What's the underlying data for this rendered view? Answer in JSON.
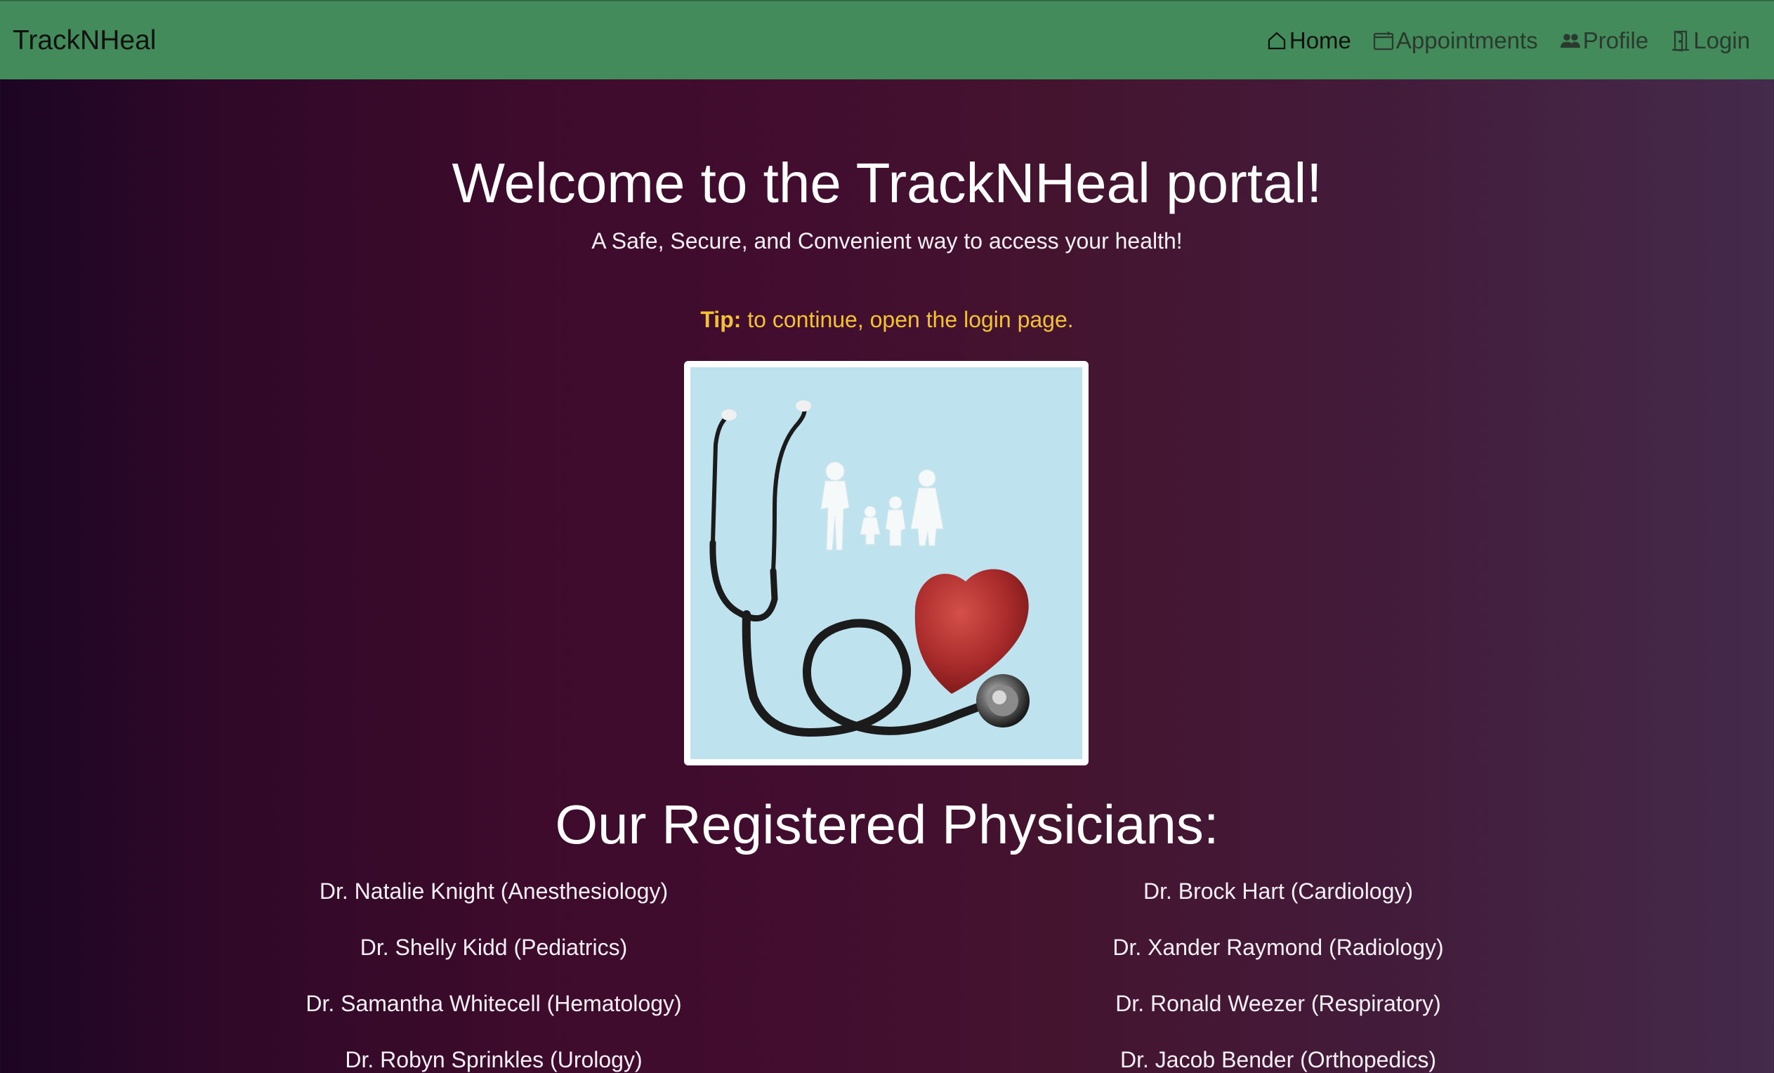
{
  "navbar": {
    "brand": "TrackNHeal",
    "links": [
      {
        "label": "Home",
        "icon": "home-icon",
        "active": true
      },
      {
        "label": "Appointments",
        "icon": "calendar-icon",
        "active": false
      },
      {
        "label": "Profile",
        "icon": "people-icon",
        "active": false
      },
      {
        "label": "Login",
        "icon": "door-icon",
        "active": false
      }
    ]
  },
  "hero": {
    "title": "Welcome to the TrackNHeal portal!",
    "subtitle": "A Safe, Secure, and Convenient way to access your health!",
    "tip_label": "Tip:",
    "tip_text": " to continue, open the login page.",
    "image_icon": "stethoscope-heart-family-image"
  },
  "physicians": {
    "title": "Our Registered Physicians:",
    "left": [
      "Dr. Natalie Knight (Anesthesiology)",
      "Dr. Shelly Kidd (Pediatrics)",
      "Dr. Samantha Whitecell (Hematology)",
      "Dr. Robyn Sprinkles (Urology)"
    ],
    "right": [
      "Dr. Brock Hart (Cardiology)",
      "Dr. Xander Raymond (Radiology)",
      "Dr. Ronald Weezer (Respiratory)",
      "Dr. Jacob Bender (Orthopedics)"
    ]
  },
  "colors": {
    "navbar": "#438b5a",
    "tip": "#f1c232",
    "text": "#ffffff"
  }
}
